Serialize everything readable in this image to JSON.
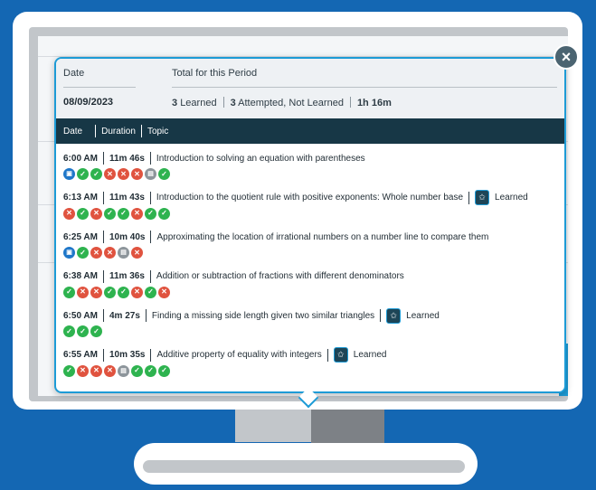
{
  "summary": {
    "date_label": "Date",
    "total_label": "Total for this Period",
    "date_value": "08/09/2023",
    "learned_count": "3",
    "learned_text": "Learned",
    "attempted_count": "3",
    "attempted_text": "Attempted, Not Learned",
    "duration_h": "1h",
    "duration_m": "16m"
  },
  "table_header": {
    "date": "Date",
    "duration": "Duration",
    "topic": "Topic"
  },
  "close_label": "×",
  "sessions": [
    {
      "time": "6:00 AM",
      "duration": "11m 46s",
      "topic": "Introduction to solving an equation with parentheses",
      "learned": null,
      "icons": [
        "info",
        "check",
        "check",
        "cross",
        "cross",
        "cross",
        "gray",
        "check"
      ]
    },
    {
      "time": "6:13 AM",
      "duration": "11m 43s",
      "topic": "Introduction to the quotient rule with positive exponents: Whole number base",
      "learned": "Learned",
      "icons": [
        "cross",
        "check",
        "cross",
        "check",
        "check",
        "cross",
        "check",
        "check"
      ]
    },
    {
      "time": "6:25 AM",
      "duration": "10m 40s",
      "topic": "Approximating the location of irrational numbers on a number line to compare them",
      "learned": null,
      "icons": [
        "info",
        "check",
        "cross",
        "cross",
        "gray",
        "cross"
      ]
    },
    {
      "time": "6:38 AM",
      "duration": "11m 36s",
      "topic": "Addition or subtraction of fractions with different denominators",
      "learned": null,
      "icons": [
        "check",
        "cross",
        "cross",
        "check",
        "check",
        "cross",
        "check",
        "cross"
      ]
    },
    {
      "time": "6:50 AM",
      "duration": "4m 27s",
      "topic": "Finding a missing side length given two similar triangles",
      "learned": "Learned",
      "icons": [
        "check",
        "check",
        "check"
      ]
    },
    {
      "time": "6:55 AM",
      "duration": "10m 35s",
      "topic": "Additive property of equality with integers",
      "learned": "Learned",
      "icons": [
        "check",
        "cross",
        "cross",
        "cross",
        "gray",
        "check",
        "check",
        "check"
      ]
    }
  ],
  "colors": {
    "header_bg": "#173746",
    "accent": "#1d9bd6",
    "check": "#2eb34f",
    "cross": "#e0533f",
    "background": "#1467b3"
  }
}
